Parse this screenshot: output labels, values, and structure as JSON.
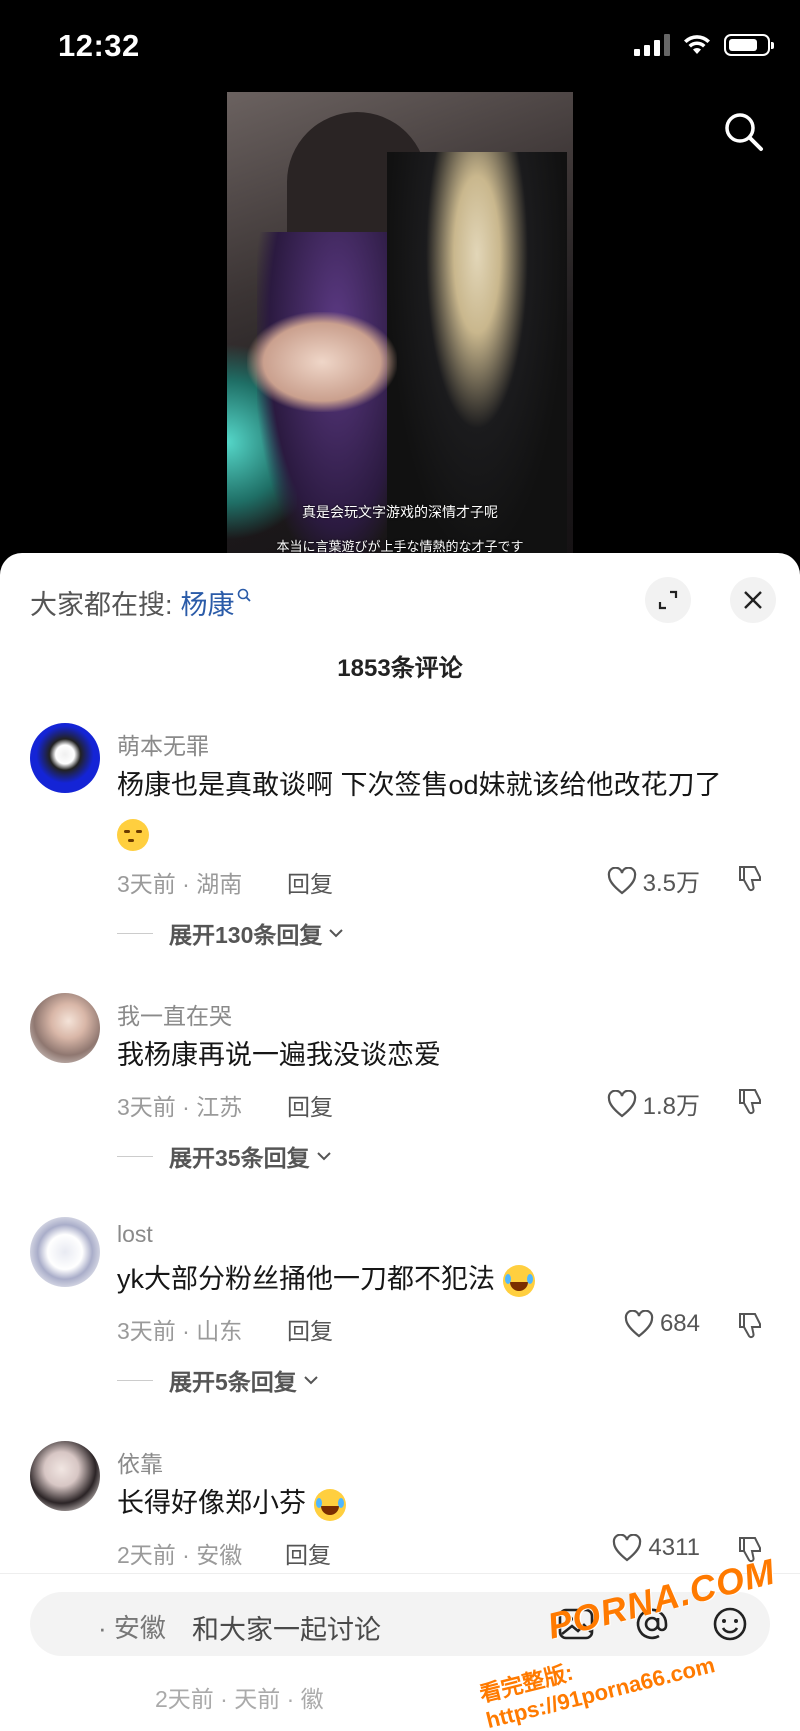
{
  "status_bar": {
    "time": "12:32"
  },
  "video": {
    "subtitle_cn": "真是会玩文字游戏的深情才子呢",
    "subtitle_jp": "本当に言葉遊びが上手な情熱的な才子です"
  },
  "sheet": {
    "hot_search_label": "大家都在搜:",
    "hot_search_term": "杨康",
    "comment_count": "1853条评论"
  },
  "comments": [
    {
      "name": "萌本无罪",
      "text": "杨康也是真敢谈啊 下次签售od妹就该给他改花刀了",
      "meta": "3天前 · 湖南",
      "reply_label": "回复",
      "likes": "3.5万",
      "expand": "展开130条回复",
      "emoji": "thinking-face"
    },
    {
      "name": "我一直在哭",
      "text": "我杨康再说一遍我没谈恋爱",
      "meta": "3天前 · 江苏",
      "reply_label": "回复",
      "likes": "1.8万",
      "expand": "展开35条回复"
    },
    {
      "name": "lost",
      "text": "yk大部分粉丝捅他一刀都不犯法",
      "meta": "3天前 · 山东",
      "reply_label": "回复",
      "likes": "684",
      "expand": "展开5条回复",
      "emoji": "laugh-cry-face"
    },
    {
      "name": "依靠",
      "text": "长得好像郑小芬",
      "meta": "2天前 · 安徽",
      "reply_label": "回复",
      "likes": "4311",
      "emoji": "laugh-cry-face"
    }
  ],
  "input_bar": {
    "placeholder": "和大家一起讨论",
    "ghost_left": "· 安徽",
    "ghost_meta": "2天前 · 天前 · 徽"
  },
  "watermark": {
    "logo": "PORNA.COM",
    "url": "看完整版: https://91porna66.com"
  },
  "colors": {
    "accent_link": "#2a5ba8",
    "watermark": "#ff7a00"
  }
}
